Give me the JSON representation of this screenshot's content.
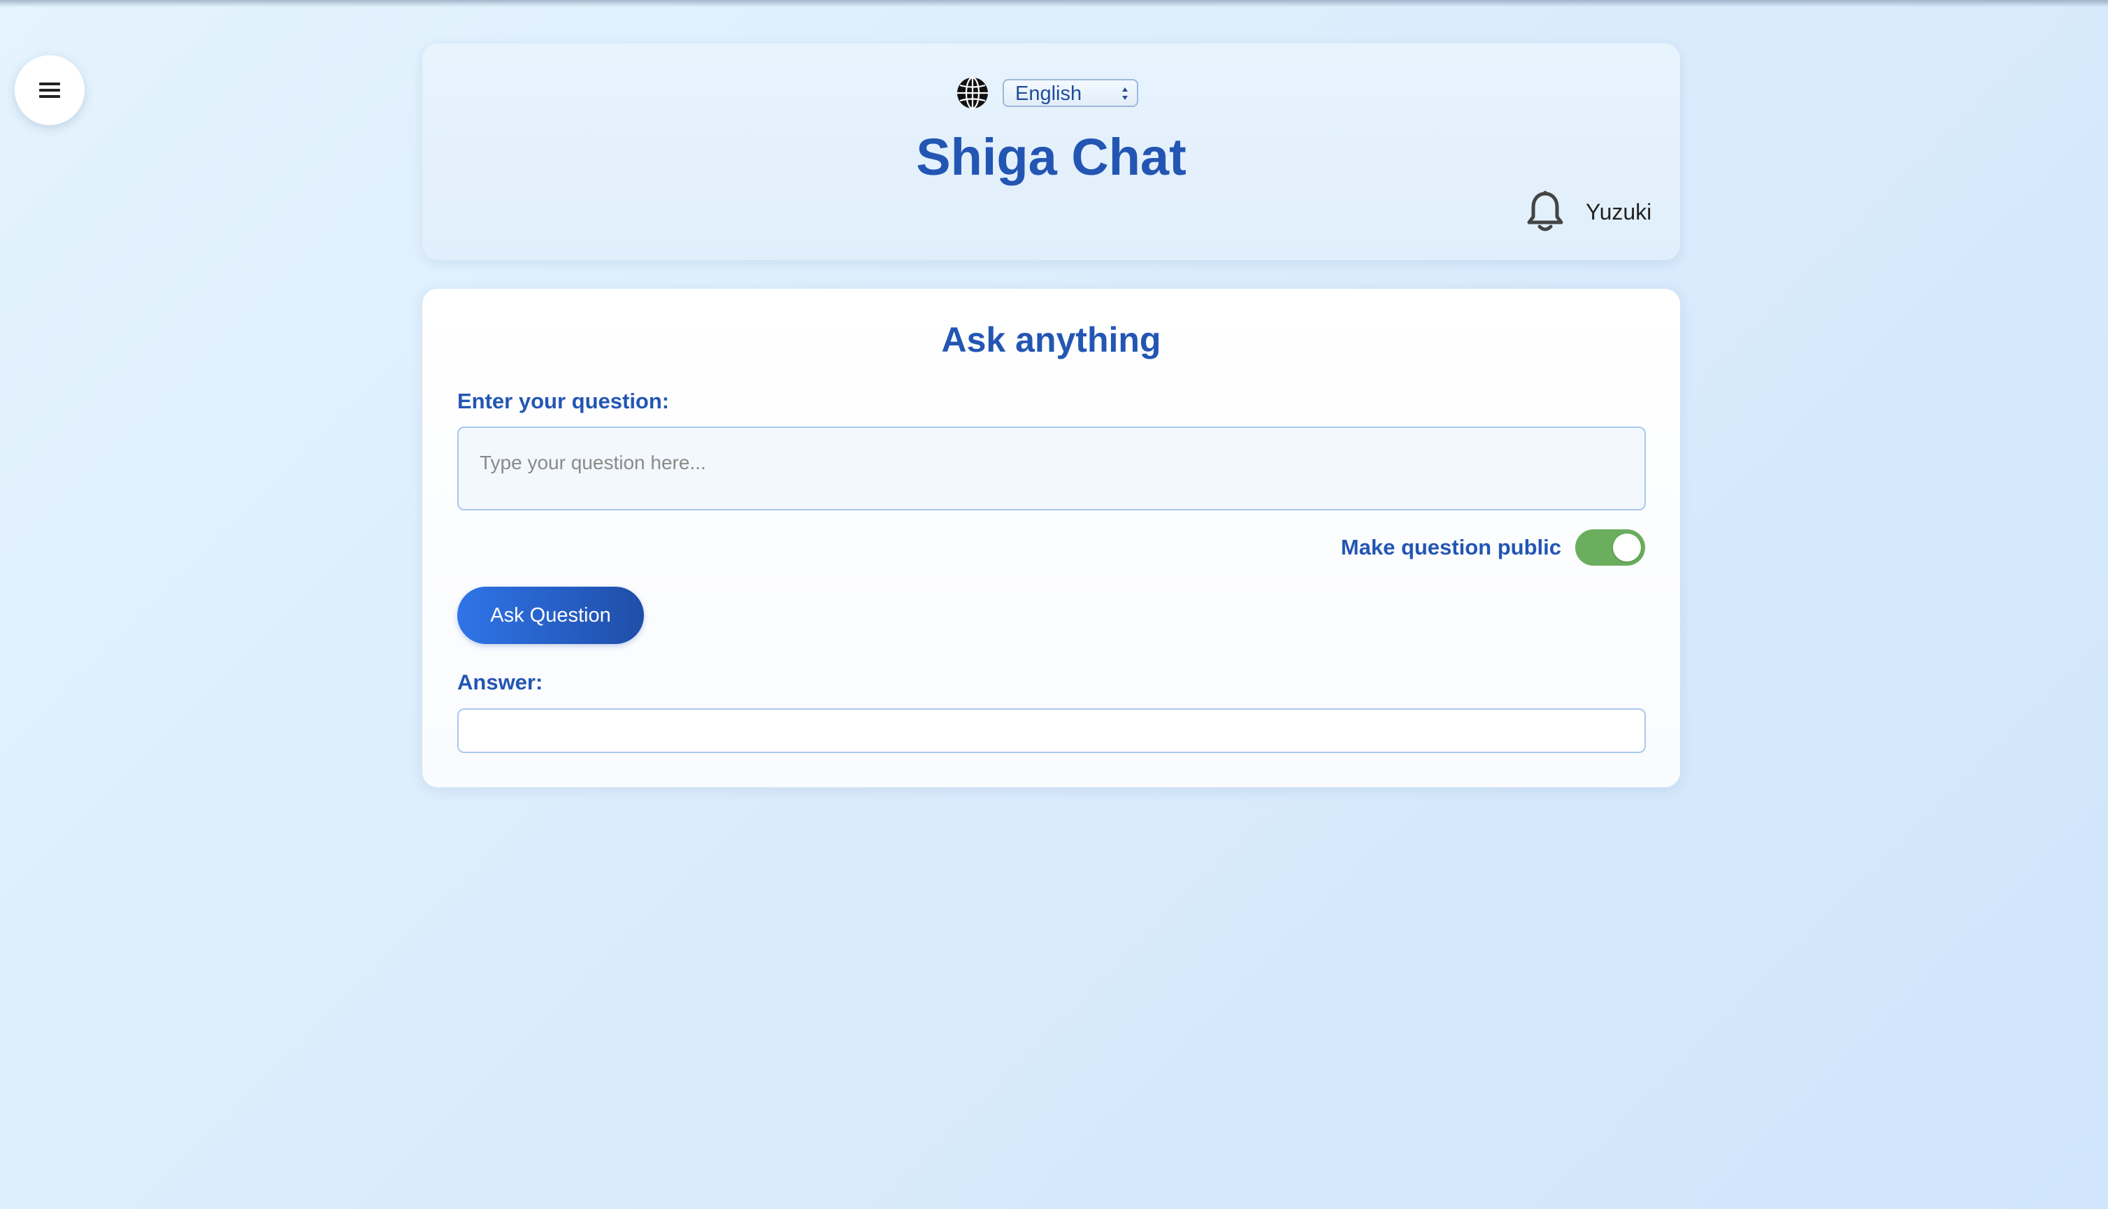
{
  "sidebar": {
    "menu_icon": "hamburger-menu-icon"
  },
  "header": {
    "globe_icon": "globe-icon",
    "language": {
      "selected": "English"
    },
    "title": "Shiga Chat",
    "notification_icon": "bell-icon",
    "username": "Yuzuki"
  },
  "main": {
    "heading": "Ask anything",
    "question_label": "Enter your question:",
    "question_placeholder": "Type your question here...",
    "question_value": "",
    "public_toggle": {
      "label": "Make question public",
      "enabled": true
    },
    "ask_button_label": "Ask Question",
    "answer_label": "Answer:",
    "answer_text": ""
  },
  "colors": {
    "accent": "#2356b3",
    "button_gradient_start": "#2f74e8",
    "button_gradient_end": "#1f4ea8",
    "toggle_on": "#6aae5e"
  }
}
